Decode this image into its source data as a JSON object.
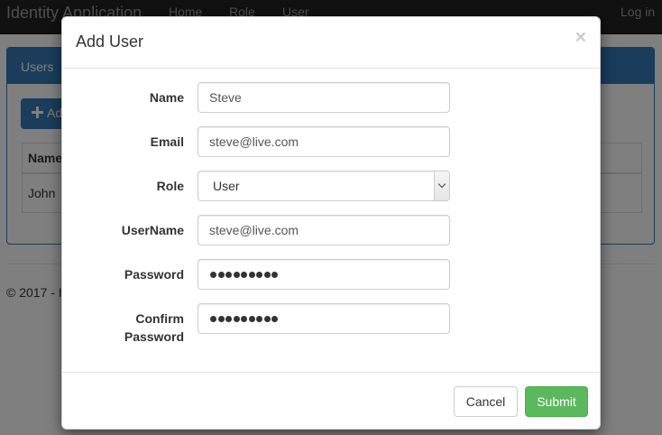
{
  "navbar": {
    "brand": "Identity Application",
    "links": [
      "Home",
      "Role",
      "User"
    ],
    "login": "Log in"
  },
  "background": {
    "panel_title": "Users",
    "add_button_label": "Ad",
    "table_header_name": "Name",
    "table_row_name": "John",
    "footer_text": "© 2017 - I"
  },
  "modal": {
    "title": "Add User",
    "close_glyph": "×",
    "fields": {
      "name": {
        "label": "Name",
        "value": "Steve"
      },
      "email": {
        "label": "Email",
        "value": "steve@live.com"
      },
      "role": {
        "label": "Role",
        "value": "User"
      },
      "username": {
        "label": "UserName",
        "value": "steve@live.com"
      },
      "password": {
        "label": "Password",
        "masked_length": 9
      },
      "confirm_password": {
        "label_line1": "Confirm",
        "label_line2": "Password",
        "masked_length": 9
      }
    },
    "cancel_label": "Cancel",
    "submit_label": "Submit"
  },
  "colors": {
    "navbar": "#222222",
    "primary": "#337ab7",
    "success": "#5cb85c"
  }
}
